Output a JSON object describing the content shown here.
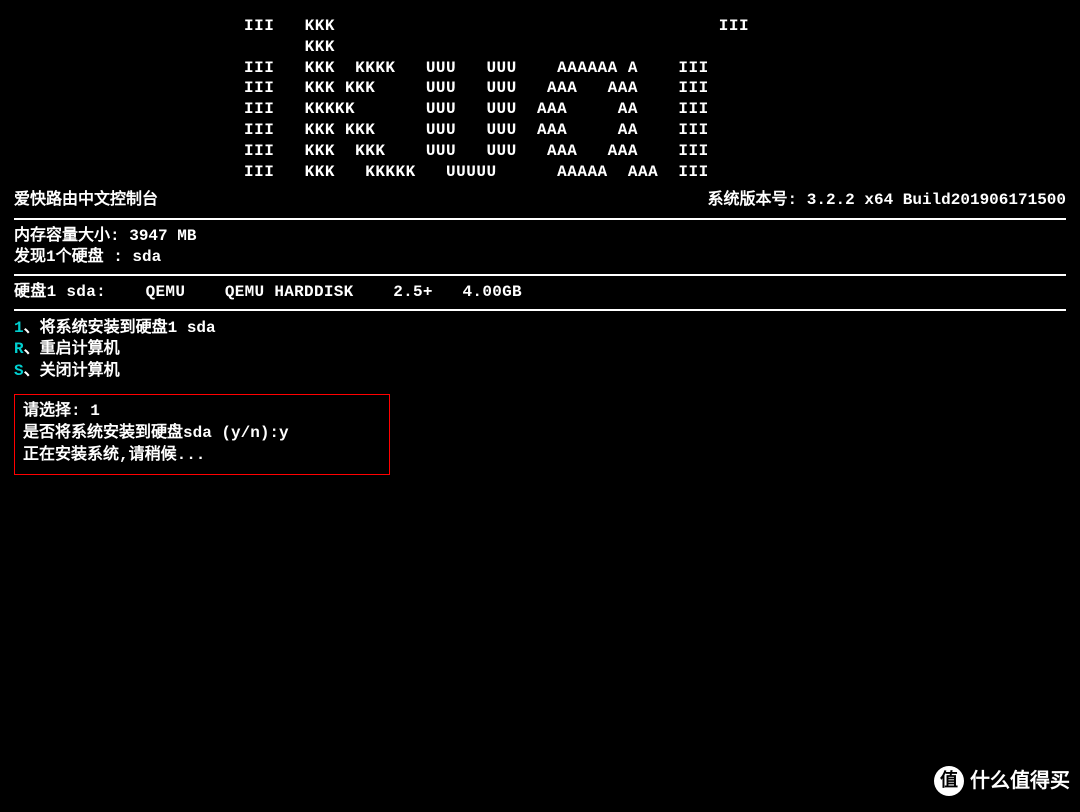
{
  "ascii_art": "III   KKK                                      III\n      KKK\nIII   KKK  KKKK   UUU   UUU    AAAAAA A    III\nIII   KKK KKK     UUU   UUU   AAA   AAA    III\nIII   KKKKK       UUU   UUU  AAA     AA    III\nIII   KKK KKK     UUU   UUU  AAA     AA    III\nIII   KKK  KKK    UUU   UUU   AAA   AAA    III\nIII   KKK   KKKKK   UUUUU      AAAAA  AAA  III",
  "header": {
    "console_title": "爱快路由中文控制台",
    "version_label": "系统版本号:",
    "version_value": "3.2.2 x64 Build201906171500"
  },
  "sysinfo": {
    "memory_label": "内存容量大小:",
    "memory_value": "3947 MB",
    "disk_found_label": "发现1个硬盘 :",
    "disk_found_value": "sda"
  },
  "disk": {
    "label": "硬盘1 sda:",
    "vendor": "QEMU",
    "model": "QEMU HARDDISK",
    "rev": "2.5+",
    "size": "4.00GB"
  },
  "menu": {
    "items": [
      {
        "key": "1",
        "sep": "、",
        "label": "将系统安装到硬盘1 sda"
      },
      {
        "key": "R",
        "sep": "、",
        "label": "重启计算机"
      },
      {
        "key": "S",
        "sep": "、",
        "label": "关闭计算机"
      }
    ]
  },
  "prompt": {
    "select_label": "请选择:",
    "select_value": "1",
    "confirm_label": "是否将系统安装到硬盘sda (y/n):",
    "confirm_value": "y",
    "installing": "正在安装系统,请稍候..."
  },
  "watermark": {
    "badge": "值",
    "text": "什么值得买"
  }
}
